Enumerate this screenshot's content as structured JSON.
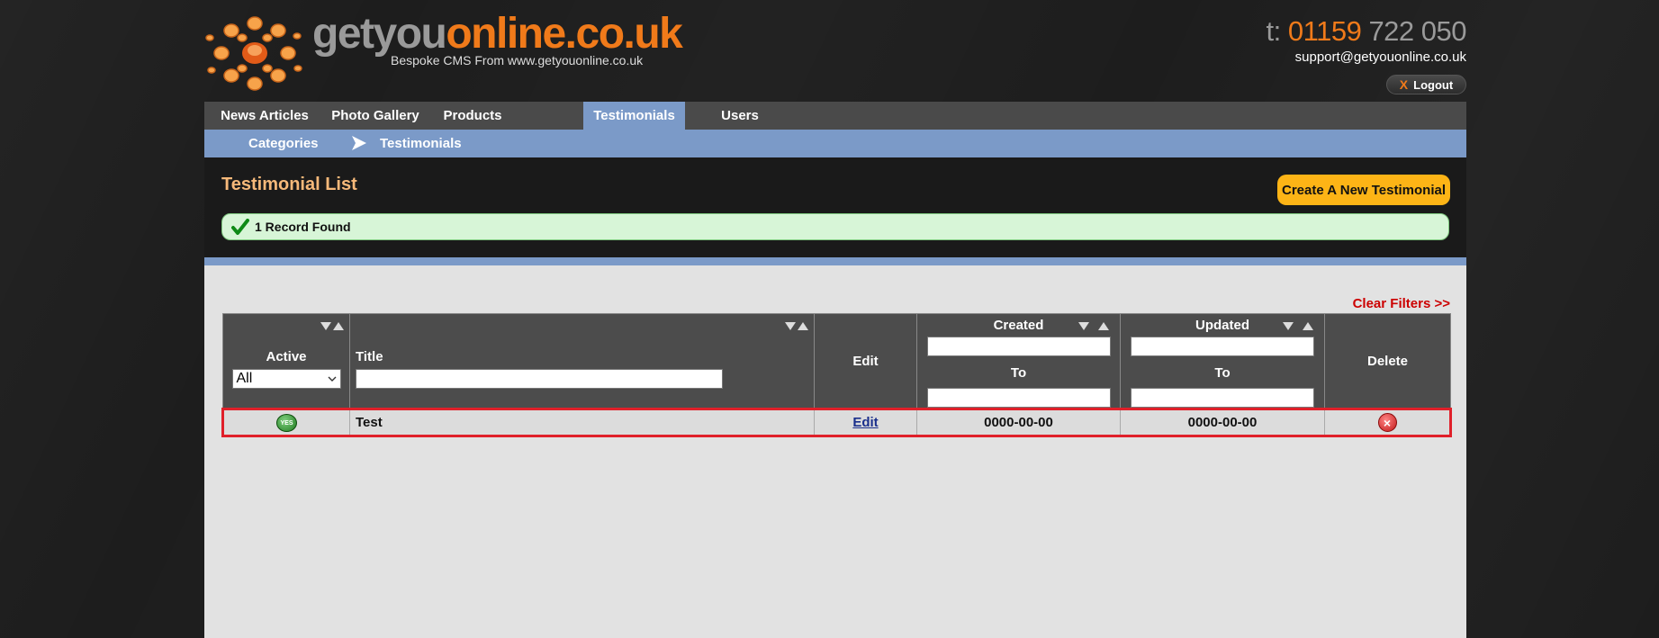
{
  "header": {
    "logo_part1": "getyou",
    "logo_part2": "online.co.uk",
    "tagline": "Bespoke CMS From www.getyouonline.co.uk",
    "phone_prefix": "t:",
    "phone_part1": "01159",
    "phone_part2": "722 050",
    "email": "support@getyouonline.co.uk",
    "logout_icon": "X",
    "logout_label": "Logout"
  },
  "main_nav": {
    "items": [
      {
        "label": "News Articles"
      },
      {
        "label": "Photo Gallery"
      },
      {
        "label": "Products"
      },
      {
        "label": "Testimonials",
        "active": true
      },
      {
        "label": "Users"
      }
    ]
  },
  "sub_nav": {
    "items": [
      {
        "label": "Categories"
      },
      {
        "label": "Testimonials"
      }
    ]
  },
  "page": {
    "title": "Testimonial List",
    "create_label": "Create A New Testimonial",
    "records_found": "1 Record Found",
    "clear_filters": "Clear Filters >>"
  },
  "table": {
    "headers": {
      "active": "Active",
      "title": "Title",
      "edit": "Edit",
      "created": "Created",
      "updated": "Updated",
      "to": "To",
      "delete": "Delete"
    },
    "active_filter_value": "All",
    "rows": [
      {
        "active_badge": "YES",
        "title": "Test",
        "edit_label": "Edit",
        "created": "0000-00-00",
        "updated": "0000-00-00"
      }
    ]
  },
  "colors": {
    "accent_orange": "#f07a1a",
    "nav_active": "#7b9ac8",
    "button_yellow": "#fdb416",
    "row_highlight": "#e0202a"
  },
  "icons": {
    "logo": "sun-logo-icon",
    "check": "check-icon",
    "arrow": "arrow-right-icon",
    "sort": "sort-arrows-icon",
    "active": "yes-badge-icon",
    "delete": "delete-x-icon"
  }
}
